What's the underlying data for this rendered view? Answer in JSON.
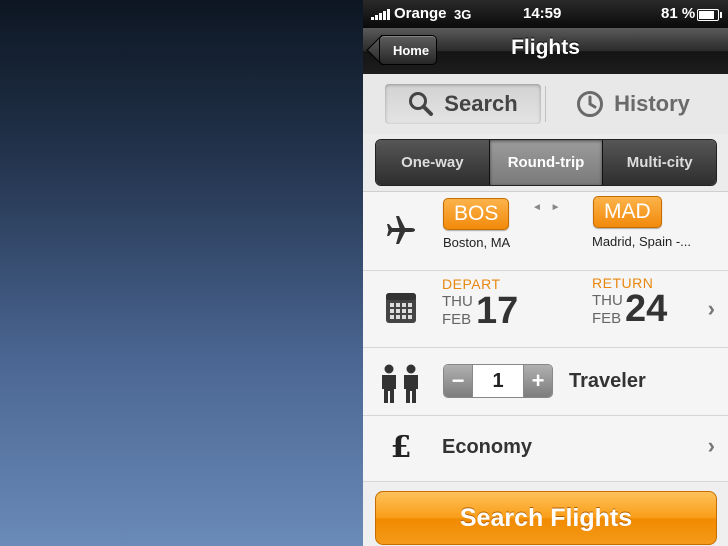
{
  "status_bar": {
    "carrier": "Orange",
    "network": "3G",
    "time": "14:59",
    "battery": "81 %"
  },
  "nav": {
    "back_label": "Home",
    "title": "Flights"
  },
  "tabs": [
    {
      "label": "Search",
      "icon": "magnifier-icon",
      "active": true
    },
    {
      "label": "History",
      "icon": "clock-icon",
      "active": false
    }
  ],
  "trip_types": [
    {
      "label": "One-way",
      "selected": false
    },
    {
      "label": "Round-trip",
      "selected": true
    },
    {
      "label": "Multi-city",
      "selected": false
    }
  ],
  "route": {
    "origin_code": "BOS",
    "origin_city": "Boston, MA",
    "swap_symbol": "◄ ►",
    "destination_code": "MAD",
    "destination_city": "Madrid, Spain -..."
  },
  "dates": {
    "depart_label": "DEPART",
    "depart_weekday": "THU",
    "depart_month": "FEB",
    "depart_day": "17",
    "return_label": "RETURN",
    "return_weekday": "THU",
    "return_month": "FEB",
    "return_day": "24"
  },
  "travelers": {
    "minus": "−",
    "count": "1",
    "plus": "+",
    "label": "Traveler"
  },
  "cabin": {
    "currency_symbol": "£",
    "label": "Economy"
  },
  "search_button": "Search Flights",
  "colors": {
    "accent": "#f39a17",
    "nav": "#1d1d1d",
    "label_orange": "#e8870f"
  }
}
